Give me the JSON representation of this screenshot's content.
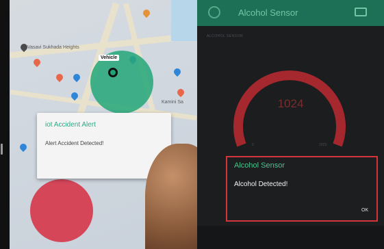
{
  "map": {
    "labels": {
      "area": "Vasavi Sukhada Heights",
      "vehicle": "Vehicle",
      "poi_top": "",
      "poi_right": "",
      "poi_bottom": "Kamini Sa"
    }
  },
  "left_dialog": {
    "title": "iot Accident Alert",
    "message": "Alert Accident Detected!"
  },
  "app": {
    "title": "Alcohol Sensor",
    "widget_label": "ALCOHOL SENSOR",
    "gauge": {
      "value": "1024",
      "min": "0",
      "max": "1023",
      "fill_fraction": 1.0
    }
  },
  "right_dialog": {
    "title": "Alcohol Sensor",
    "message": "Alcohol Detected!",
    "ok_label": "OK"
  },
  "colors": {
    "accent_green": "#49c48f",
    "alert_red": "#d4353d",
    "header_green": "#1d6f55"
  }
}
